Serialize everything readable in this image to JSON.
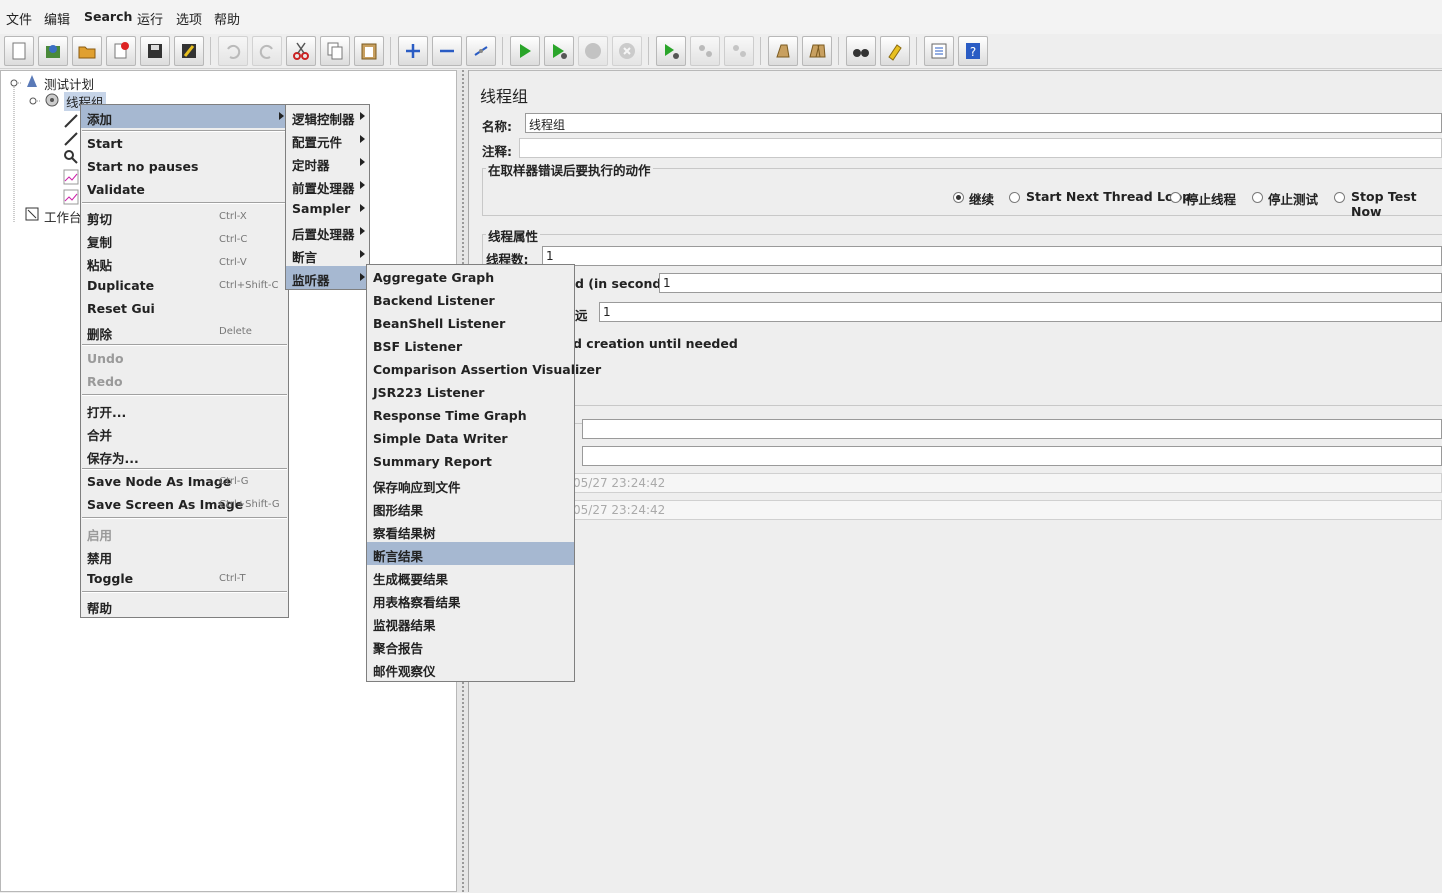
{
  "menubar": [
    "文件",
    "编辑",
    "Search",
    "运行",
    "选项",
    "帮助"
  ],
  "tree": {
    "root": "测试计划",
    "thread_group": "线程组",
    "workbench": "工作台"
  },
  "panel": {
    "title": "线程组",
    "name_label": "名称:",
    "name_value": "线程组",
    "comment_label": "注释:",
    "error_group_title": "在取样器错误后要执行的动作",
    "radios": [
      "继续",
      "Start Next Thread Loop",
      "停止线程",
      "停止测试",
      "Stop Test Now"
    ],
    "thread_props_title": "线程属性",
    "threads_label": "线程数:",
    "threads_value": "1",
    "rampup_label_partial": "d (in seconds):",
    "rampup_value": "1",
    "loop_label_partial": "远",
    "loop_value": "1",
    "delay_partial": "d creation until needed",
    "start_time_partial": "05/27 23:24:42",
    "end_time_partial": "05/27 23:24:42"
  },
  "context_menu": {
    "items": [
      {
        "label": "添加",
        "shortcut": "",
        "state": "sel",
        "sub": true
      },
      {
        "label": "Start",
        "shortcut": ""
      },
      {
        "label": "Start no pauses",
        "shortcut": ""
      },
      {
        "label": "Validate",
        "shortcut": ""
      },
      {
        "label": "剪切",
        "shortcut": "Ctrl-X"
      },
      {
        "label": "复制",
        "shortcut": "Ctrl-C"
      },
      {
        "label": "粘贴",
        "shortcut": "Ctrl-V"
      },
      {
        "label": "Duplicate",
        "shortcut": "Ctrl+Shift-C"
      },
      {
        "label": "Reset Gui",
        "shortcut": ""
      },
      {
        "label": "删除",
        "shortcut": "Delete"
      },
      {
        "label": "Undo",
        "shortcut": "",
        "state": "dis"
      },
      {
        "label": "Redo",
        "shortcut": "",
        "state": "dis"
      },
      {
        "label": "打开...",
        "shortcut": ""
      },
      {
        "label": "合并",
        "shortcut": ""
      },
      {
        "label": "保存为...",
        "shortcut": ""
      },
      {
        "label": "Save Node As Image",
        "shortcut": "Ctrl-G"
      },
      {
        "label": "Save Screen As Image",
        "shortcut": "Ctrl+Shift-G"
      },
      {
        "label": "启用",
        "shortcut": "",
        "state": "dis"
      },
      {
        "label": "禁用",
        "shortcut": ""
      },
      {
        "label": "Toggle",
        "shortcut": "Ctrl-T"
      },
      {
        "label": "帮助",
        "shortcut": ""
      }
    ]
  },
  "add_menu": {
    "items": [
      "逻辑控制器",
      "配置元件",
      "定时器",
      "前置处理器",
      "Sampler",
      "后置处理器",
      "断言",
      "监听器"
    ],
    "selected": "监听器"
  },
  "listener_menu": {
    "items": [
      "Aggregate Graph",
      "Backend Listener",
      "BeanShell Listener",
      "BSF Listener",
      "Comparison Assertion Visualizer",
      "JSR223 Listener",
      "Response Time Graph",
      "Simple Data Writer",
      "Summary Report",
      "保存响应到文件",
      "图形结果",
      "察看结果树",
      "断言结果",
      "生成概要结果",
      "用表格察看结果",
      "监视器结果",
      "聚合报告",
      "邮件观察仪"
    ],
    "selected": "断言结果"
  },
  "colors": {
    "selection": "#a6b8d1",
    "menu_bg": "#eeeeee",
    "run_green": "#2aa52a"
  }
}
